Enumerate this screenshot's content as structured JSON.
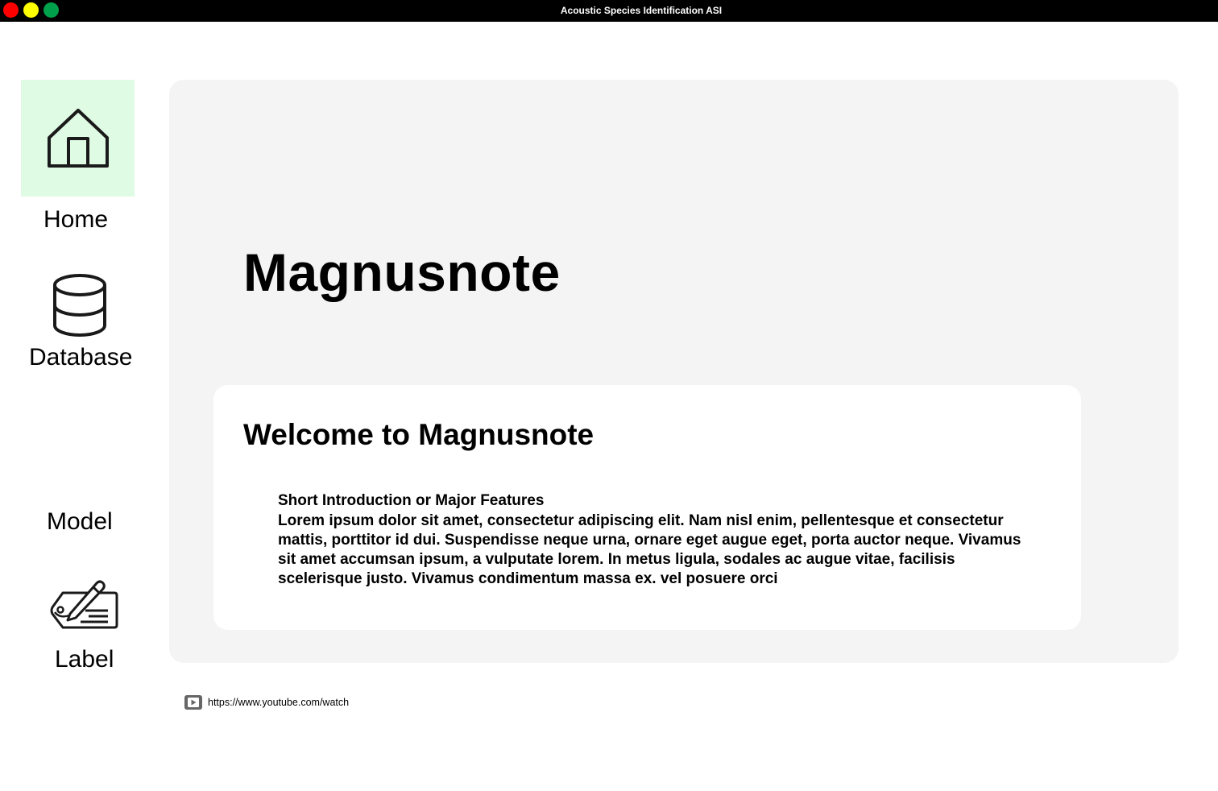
{
  "window": {
    "title": "Acoustic Species Identification ASI",
    "controls": [
      "close",
      "minimize",
      "maximize"
    ]
  },
  "sidebar": {
    "items": [
      {
        "id": "home",
        "label": "Home",
        "icon": "home-icon",
        "active": true
      },
      {
        "id": "database",
        "label": "Database",
        "icon": "database-icon",
        "active": false
      },
      {
        "id": "model",
        "label": "Model",
        "icon": "",
        "active": false
      },
      {
        "id": "label",
        "label": "Label",
        "icon": "label-tag-icon",
        "active": false
      }
    ]
  },
  "main": {
    "app_title": "Magnusnote",
    "welcome": {
      "heading": "Welcome to Magnusnote",
      "subheading": "Short Introduction or Major Features",
      "body": "Lorem ipsum dolor sit amet, consectetur adipiscing elit. Nam nisl enim, pellentesque et consectetur mattis, porttitor id dui. Suspendisse neque urna, ornare eget augue eget, porta auctor neque. Vivamus sit amet accumsan ipsum, a vulputate lorem. In metus ligula, sodales ac augue vitae, facilisis scelerisque justo. Vivamus condimentum massa ex. vel posuere orci"
    }
  },
  "footer": {
    "video_link": "https://www.youtube.com/watch",
    "video_icon": "video-play-icon"
  },
  "colors": {
    "titlebar": "#000000",
    "active_nav_background": "#dffbe4",
    "panel_background": "#f4f4f4",
    "card_background": "#ffffff"
  }
}
